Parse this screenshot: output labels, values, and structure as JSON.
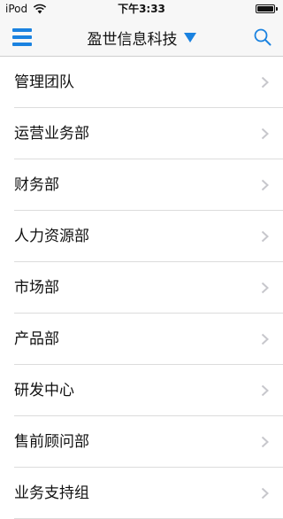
{
  "status_bar": {
    "carrier": "iPod",
    "time": "下午3:33"
  },
  "nav": {
    "title": "盈世信息科技",
    "menu_icon": "hamburger-menu-icon",
    "search_icon": "search-icon",
    "dropdown_icon": "triangle-down-icon"
  },
  "departments": [
    {
      "label": "管理团队"
    },
    {
      "label": "运营业务部"
    },
    {
      "label": "财务部"
    },
    {
      "label": "人力资源部"
    },
    {
      "label": "市场部"
    },
    {
      "label": "产品部"
    },
    {
      "label": "研发中心"
    },
    {
      "label": "售前顾问部"
    },
    {
      "label": "业务支持组"
    }
  ],
  "colors": {
    "accent": "#1a82e0",
    "chevron": "#c7c7cc",
    "separator": "#dcdcdc",
    "bar_background": "#f7f7f7"
  }
}
